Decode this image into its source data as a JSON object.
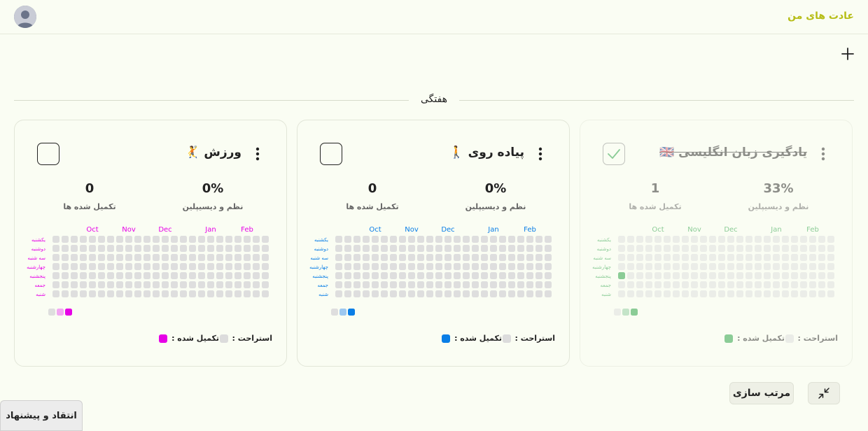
{
  "app": {
    "title": "عادت های من"
  },
  "section": {
    "title": "هفتگی"
  },
  "labels": {
    "discipline": "نظم و دیسیپلین",
    "completed": "تکمیل شده ها",
    "rest": "استراحت :",
    "done": "تکمیل شده :"
  },
  "months": [
    "Oct",
    "Nov",
    "Dec",
    "Jan",
    "Feb"
  ],
  "weekdays": [
    "یکشنبه",
    "دوشنبه",
    "سه شنبه",
    "چهارشنبه",
    "پنجشنبه",
    "جمعه",
    "شنبه"
  ],
  "cards": [
    {
      "title": "ورزش 🤾",
      "discipline": "0%",
      "completed": "0",
      "color": "#e600e6",
      "light": "#f2a6f2",
      "checked": false,
      "filled": []
    },
    {
      "title": "پیاده روی 🚶",
      "discipline": "0%",
      "completed": "0",
      "color": "#0a7ee6",
      "light": "#9dc8f0",
      "checked": false,
      "filled": []
    },
    {
      "title": "یادگیری زبان انگلیسی 🇬🇧",
      "discipline": "33%",
      "completed": "1",
      "color": "#1e9c3c",
      "light": "#8fcc9e",
      "checked": true,
      "filled": [
        [
          0,
          4
        ]
      ]
    }
  ],
  "buttons": {
    "sort": "مرتب سازی",
    "feedback": "انتقاد و پیشنهاد"
  },
  "icons": {
    "avatar": "user-avatar",
    "plus": "plus-icon",
    "collapse": "collapse-icon",
    "kebab": "more-vertical-icon"
  }
}
